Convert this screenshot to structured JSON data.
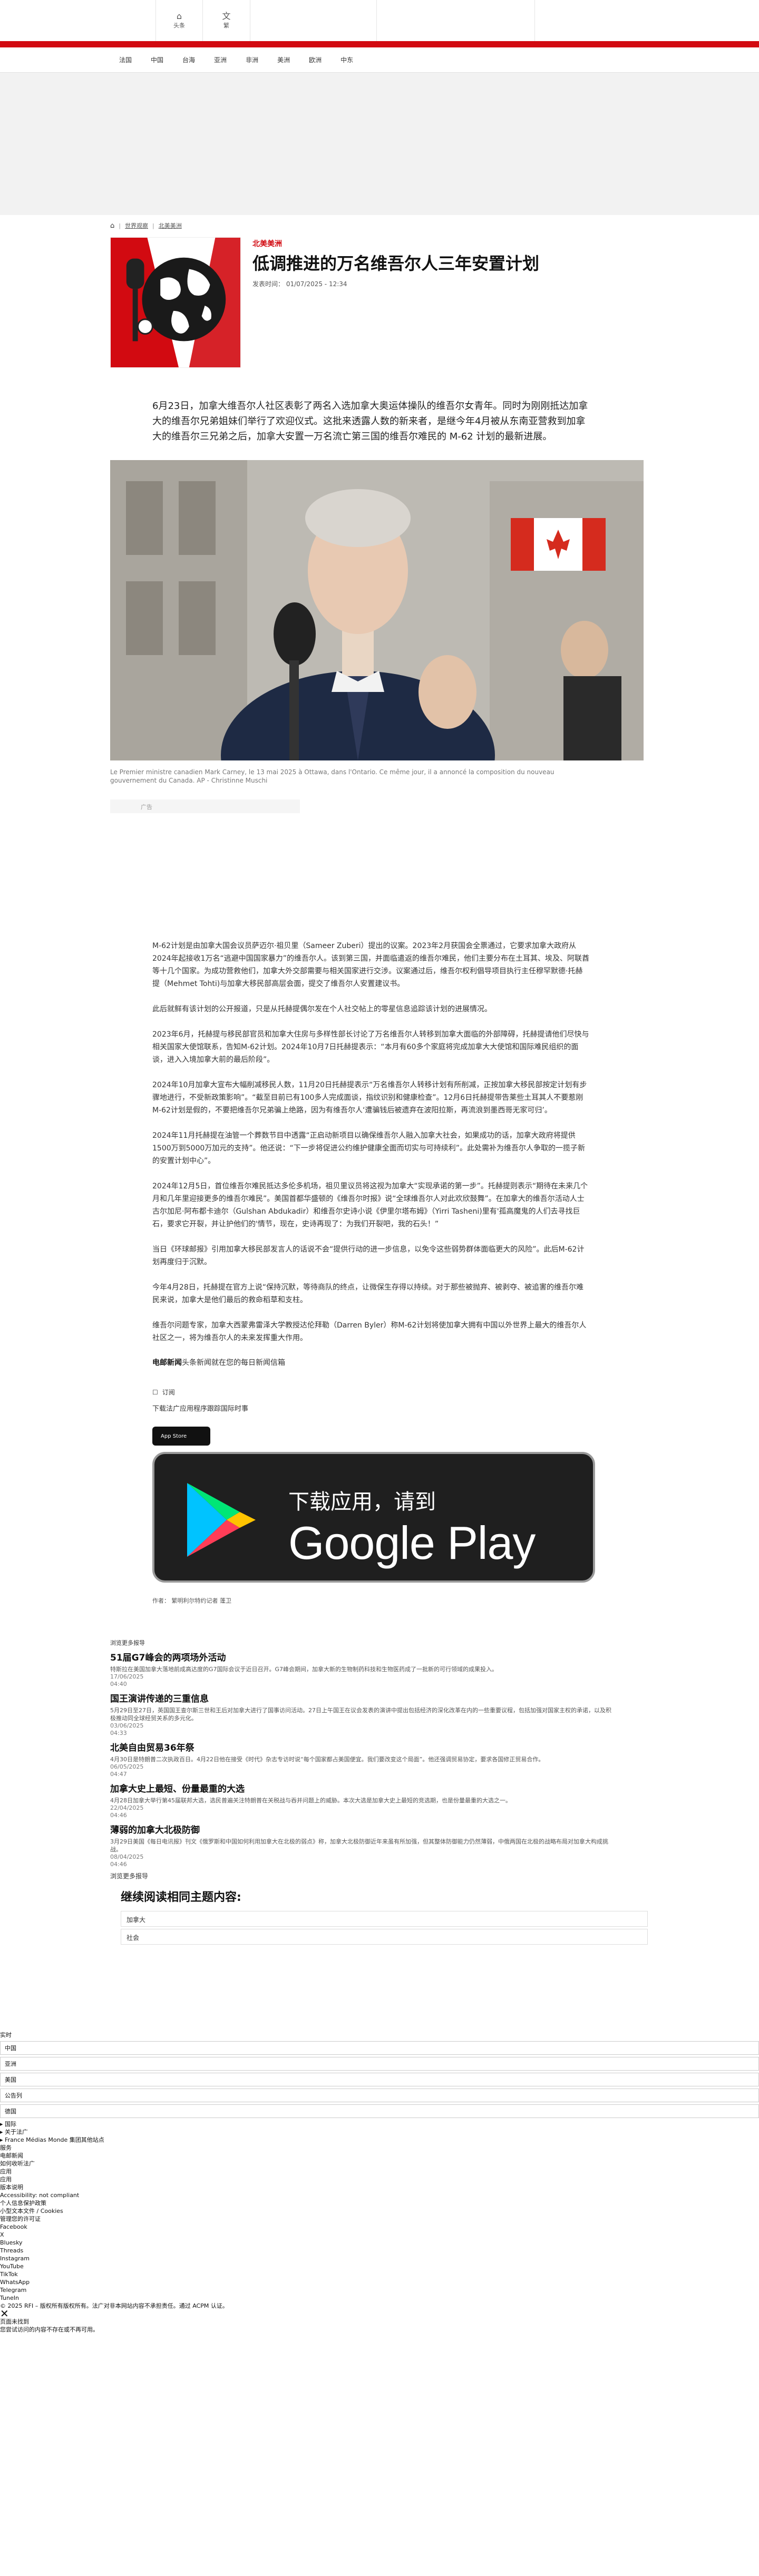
{
  "topbar": {
    "home_label": "头条",
    "lang_label": "繁"
  },
  "nav": [
    "法国",
    "中国",
    "台海",
    "亚洲",
    "非洲",
    "美洲",
    "欧洲",
    "中东"
  ],
  "breadcrumb": {
    "home_icon": "home-icon",
    "items": [
      "世界观察",
      "北美美洲"
    ]
  },
  "article": {
    "kicker": "北美美洲",
    "title": "低调推进的万名维吾尔人三年安置计划",
    "published": "发表时间： 01/07/2025 - 12:34",
    "lead": "6月23日，加拿大维吾尔人社区表彰了两名入选加拿大奥运体操队的维吾尔女青年。同时为刚刚抵达加拿大的维吾尔兄弟姐妹们举行了欢迎仪式。这批来透露人数的新来者，是继今年4月被从东南亚营救到加拿大的维吾尔三兄弟之后，加拿大安置一万名流亡第三国的维吾尔难民的 M-62 计划的最新进展。",
    "photo_caption": "Le Premier ministre canadien Mark Carney, le 13 mai 2025 à Ottawa, dans l'Ontario. Ce même jour, il a annoncé la composition du nouveau gouvernement du Canada. AP - Christinne Muschi",
    "ad_label": "广告",
    "paragraphs": [
      "M-62计划是由加拿大国会议员萨迈尔·祖贝里（Sameer Zuberi）提出的议案。2023年2月获国会全票通过，它要求加拿大政府从2024年起接收1万名“逃避中国国家暴力”的维吾尔人。该到第三国，并面临遣返的维吾尔难民，他们主要分布在土耳其、埃及、阿联酋等十几个国家。为成功营救他们，加拿大外交部需要与相关国家进行交涉。议案通过后，维吾尔权利倡导项目执行主任穆罕默德·托赫提（Mehmet Tohti)与加拿大移民部高层会面，提交了维吾尔人安置建议书。",
      "此后就鲜有该计划的公开报道，只是从托赫提偶尔发在个人社交帖上的零星信息追踪该计划的进展情况。",
      "2023年6月，托赫提与移民部官员和加拿大住房与多样性部长讨论了万名维吾尔人转移到加拿大面临的外部障碍，托赫提请他们尽快与相关国家大使馆联系，告知M-62计划。2024年10月7日托赫提表示：“本月有60多个家庭将完成加拿大大使馆和国际难民组织的面谈，进入入境加拿大前的最后阶段”。",
      "2024年10月加拿大宣布大幅削减移民人数，11月20日托赫提表示“万名维吾尔人转移计划有所削减，正按加拿大移民部按定计划有步骤地进行，不受新政策影响”。“截至目前已有100多人完成面谈，指纹识别和健康检查”。12月6日托赫提带告莱些土耳其人不要惹刚M-62计划是假的，不要把维吾尔兄弟骗上绝路，因为有维吾尔人‘遭骗钱后被遗弃在波阳拉斯，再流浪到墨西哥无家可归’。",
      "2024年11月托赫提在油管一个葬数节目中透露“正启动新项目以确保维吾尔人融入加拿大社会，如果成功的话，加拿大政府将提供1500万到5000万加元的支持”。他还说：“下一步将促进公约维护健康全面而切实与可持续利”。此处需补为维吾尔人争取的一揽子新的安置计划中心”。",
      "2024年12月5日，首位维吾尔难民抵达多伦多机场，祖贝里议员将这视为加拿大“实现承诺的第一步”。托赫提则表示“期待在未来几个月和几年里迎接更多的维吾尔难民”。美国首都华盛顿的《维吾尔时报》说“全球维吾尔人对此欢欣鼓舞”。在加拿大的维吾尔活动人士古尔加尼·阿布都卡迪尔（Gulshan Abdukadir）和维吾尔史诗小说《伊里尔塔布姆》（Yirri Tasheni)里有'孤高魔鬼的人们去寻找巨石，要求它开裂，并让护他们的'情节，现在，史诗再现了：为我们开裂吧，我的石头！”",
      "当日《环球邮报》引用加拿大移民部发言人的话说不会“提供行动的进一步信息，以免令这些弱势群体面临更大的风险”。此后M-62计划再度归于沉默。",
      "今年4月28日，托赫提在官方上说“保持沉默，等待商队的终点，让微保生存得以持续。对于那些被抛弃、被剥夺、被追害的维吾尔难民来说，加拿大是他们最后的救命稻草和支柱。",
      "维吾尔问题专家，加拿大西蒙弗雷泽大学教授达伦拜勒（Darren Byler）称M-62计划将使加拿大拥有中国以外世界上最大的维吾尔人社区之一，将为维吾尔人的未来发挥重大作用。"
    ],
    "signoff_brand": "电邮新闻",
    "signoff_text": "头条新闻就在您的每日新闻信箱",
    "share_label": "订阅",
    "download_text": "下载法广应用程序跟踪国际时事",
    "appstore_label": "App Store",
    "gplay_small": "下载应用，请到",
    "gplay_big": "Google Play",
    "author": "作者： 繁明利尔特约记者 蓬卫"
  },
  "related": {
    "heading": "浏览更多报导",
    "items": [
      {
        "title": "51届G7峰会的两项场外活动",
        "desc": "特斯拉在美国加拿大落地前成高达度的G7国际会议于近日召开。G7峰会期间，加拿大新的生物制药科技和生物医药成了一批新的可行领域的成果投入。",
        "date": "17/06/2025",
        "time": "04:40"
      },
      {
        "title": "国王演讲传递的三重信息",
        "desc": "5月29日至27日，英国国王查尔斯三世和王后对加拿大进行了国事访问活动。27日上午国王在议会发表的演讲中提出包括经济的深化改革在内的一些重要议程，包括加强对国家主权的承诺，以及积极推动同全球经贸关系的多元化。",
        "date": "03/06/2025",
        "time": "04:33"
      },
      {
        "title": "北美自由贸易36年祭",
        "desc": "4月30日是特朗普二次执政百日。4月22日他在接受《时代》杂志专访时说“每个国家都占美国便宜。我们要改变这个局面”。他还强调贸易协定，要求各国修正贸易合作。",
        "date": "06/05/2025",
        "time": "04:47"
      },
      {
        "title": "加拿大史上最短、份量最重的大选",
        "desc": "4月28日加拿大举行第45届联邦大选，选民普遍关注特朗普在关税战与吞并问题上的威胁。本次大选是加拿大史上最短的竞选期，也是份量最重的大选之一。",
        "date": "22/04/2025",
        "time": "04:46"
      },
      {
        "title": "薄弱的加拿大北极防御",
        "desc": "3月29日美国《每日电讯报》刊文《俄罗斯和中国如何利用加拿大在北极的弱点》称，加拿大北极防御近年来虽有所加强，但其整体防御能力仍然薄弱，中俄两国在北极的战略布局对加拿大构成挑战。",
        "date": "08/04/2025",
        "time": "04:46"
      }
    ]
  },
  "more": {
    "heading": "浏览更多报导",
    "topics_title": "继续阅读相同主题内容:",
    "topics": [
      "加拿大",
      "社会"
    ]
  },
  "footer": {
    "lines_top": [
      "实时"
    ],
    "selects": [
      "中国",
      "亚洲",
      "美国",
      "公告列",
      "德国"
    ],
    "lines": [
      "▸ 国际",
      "▸ 关于法广",
      "▸ France Médias Monde 集团其他站点",
      "服务",
      "电邮新闻",
      "如何收听法广",
      "应用",
      "应用",
      "",
      "版本说明",
      "Accessibility: not compliant",
      "个人信息保护政策",
      "小型文本文件 / Cookies",
      "管理您的许可证",
      "Facebook",
      "X",
      "Bluesky",
      "Threads",
      "Instagram",
      "YouTube",
      "TikTok",
      "WhatsApp",
      "Telegram",
      "TuneIn",
      "© 2025 RFI – 版权所有版权所有。法广对非本网站内容不承担责任。通过 ACPM 认证。"
    ],
    "notice_title": "页面未找到",
    "notice_text": "您尝试访问的内容不存在或不再可用。"
  },
  "colors": {
    "brand_red": "#d20a11",
    "kicker_red": "#d20a11"
  }
}
